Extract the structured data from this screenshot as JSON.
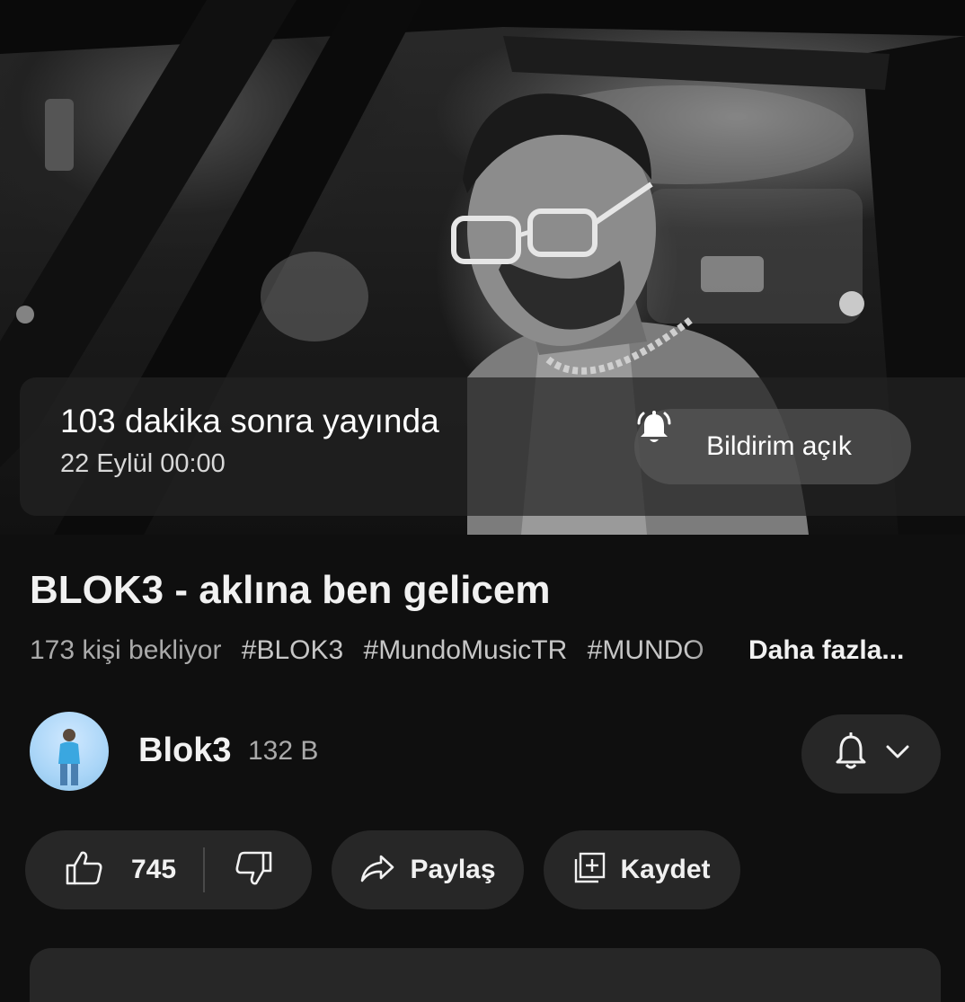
{
  "premiere": {
    "countdown": "103 dakika sonra yayında",
    "date": "22 Eylül 00:00",
    "notify_label": "Bildirim açık"
  },
  "video": {
    "title": "BLOK3 - aklına ben gelicem",
    "waiting": "173 kişi bekliyor",
    "tags": [
      "#BLOK3",
      "#MundoMusicTR",
      "#MUNDO"
    ],
    "more": "Daha fazla..."
  },
  "channel": {
    "name": "Blok3",
    "subscribers": "132 B"
  },
  "actions": {
    "like_count": "745",
    "share_label": "Paylaş",
    "save_label": "Kaydet"
  }
}
